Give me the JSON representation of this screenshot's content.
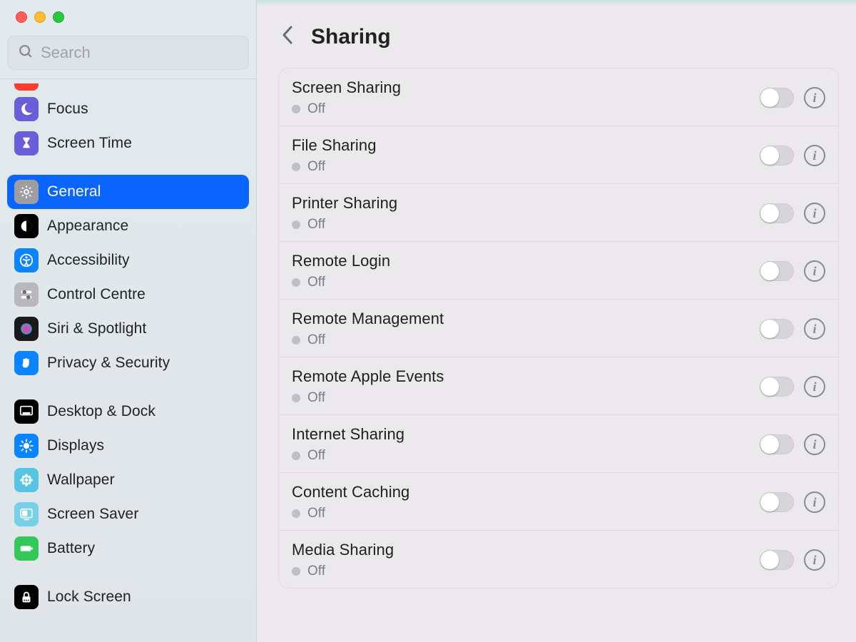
{
  "search": {
    "placeholder": "Search"
  },
  "sidebar": {
    "items": [
      {
        "id": "focus",
        "label": "Focus",
        "color": "#6b5ed9",
        "icon": "moon"
      },
      {
        "id": "screen-time",
        "label": "Screen Time",
        "color": "#6b5ed9",
        "icon": "hourglass"
      },
      {
        "id": "general",
        "label": "General",
        "color": "#8e8e93",
        "icon": "gear",
        "selected": true
      },
      {
        "id": "appearance",
        "label": "Appearance",
        "color": "#000000",
        "icon": "contrast"
      },
      {
        "id": "accessibility",
        "label": "Accessibility",
        "color": "#0a84ff",
        "icon": "person-circle"
      },
      {
        "id": "control-centre",
        "label": "Control Centre",
        "color": "#b8b8bd",
        "icon": "sliders"
      },
      {
        "id": "siri",
        "label": "Siri & Spotlight",
        "color": "#1a1a1a",
        "icon": "siri"
      },
      {
        "id": "privacy",
        "label": "Privacy & Security",
        "color": "#0a84ff",
        "icon": "hand"
      },
      {
        "id": "desktop-dock",
        "label": "Desktop & Dock",
        "color": "#000000",
        "icon": "dock"
      },
      {
        "id": "displays",
        "label": "Displays",
        "color": "#0a84ff",
        "icon": "sun"
      },
      {
        "id": "wallpaper",
        "label": "Wallpaper",
        "color": "#55c5e2",
        "icon": "flower"
      },
      {
        "id": "screensaver",
        "label": "Screen Saver",
        "color": "#77d1e6",
        "icon": "screensaver"
      },
      {
        "id": "battery",
        "label": "Battery",
        "color": "#34c759",
        "icon": "battery"
      },
      {
        "id": "lock-screen",
        "label": "Lock Screen",
        "color": "#000000",
        "icon": "lock"
      }
    ]
  },
  "header": {
    "title": "Sharing"
  },
  "rows": [
    {
      "title": "Screen Sharing",
      "status": "Off",
      "on": false
    },
    {
      "title": "File Sharing",
      "status": "Off",
      "on": false
    },
    {
      "title": "Printer Sharing",
      "status": "Off",
      "on": false
    },
    {
      "title": "Remote Login",
      "status": "Off",
      "on": false
    },
    {
      "title": "Remote Management",
      "status": "Off",
      "on": false
    },
    {
      "title": "Remote Apple Events",
      "status": "Off",
      "on": false
    },
    {
      "title": "Internet Sharing",
      "status": "Off",
      "on": false
    },
    {
      "title": "Content Caching",
      "status": "Off",
      "on": false
    },
    {
      "title": "Media Sharing",
      "status": "Off",
      "on": false
    }
  ]
}
